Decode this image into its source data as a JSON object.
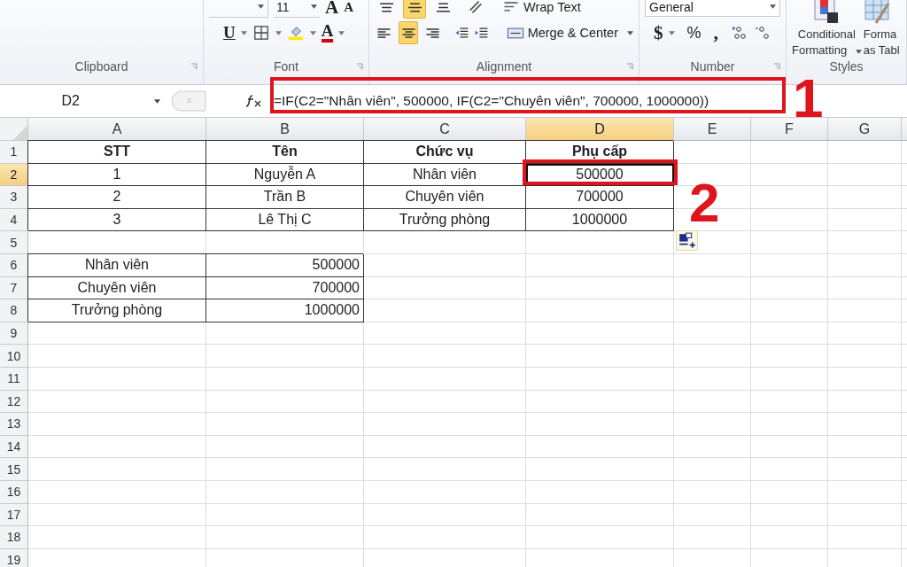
{
  "ribbon": {
    "groups": [
      {
        "kind": "clipboard",
        "label": "Clipboard",
        "launcher": true
      },
      {
        "kind": "font",
        "label": "Font",
        "launcher": true,
        "font_size": "11",
        "grow": "A",
        "shrink": "A",
        "underline": "U",
        "font_color": "A"
      },
      {
        "kind": "alignment",
        "label": "Alignment",
        "launcher": true,
        "vertical_align": [
          {
            "selected": false
          },
          {
            "selected": true
          },
          {
            "selected": false
          }
        ],
        "horizontal_align": [
          {
            "selected": false
          },
          {
            "selected": true
          },
          {
            "selected": false
          }
        ],
        "wrap_text": "Wrap Text",
        "merge": "Merge & Center"
      },
      {
        "kind": "number",
        "label": "Number",
        "launcher": true,
        "format": "General",
        "currency": "$",
        "percent": "%",
        "comma": ","
      },
      {
        "kind": "styles",
        "label": "Styles",
        "launcher": false,
        "conditional": [
          "Conditional",
          "Formatting"
        ],
        "format_table": [
          "Forma",
          "as Tabl"
        ]
      }
    ]
  },
  "formula_bar": {
    "name_box": "D2",
    "formula": "=IF(C2=\"Nhân viên\", 500000, IF(C2=\"Chuyên viên\", 700000, 1000000))"
  },
  "sheet": {
    "columns": [
      {
        "label": "A",
        "selected": false
      },
      {
        "label": "B",
        "selected": false
      },
      {
        "label": "C",
        "selected": false
      },
      {
        "label": "D",
        "selected": true
      },
      {
        "label": "E",
        "selected": false
      },
      {
        "label": "F",
        "selected": false
      },
      {
        "label": "G",
        "selected": false
      }
    ],
    "rows": [
      {
        "label": "1",
        "selected": false,
        "cells": [
          {
            "text": "STT",
            "kind": "centered",
            "bold": true,
            "border": true,
            "selected": false
          },
          {
            "text": "Tên",
            "kind": "centered",
            "bold": true,
            "border": true,
            "selected": false
          },
          {
            "text": "Chức vụ",
            "kind": "centered",
            "bold": true,
            "border": true,
            "selected": false
          },
          {
            "text": "Phụ cấp",
            "kind": "centered",
            "bold": true,
            "border": true,
            "selected": false
          }
        ]
      },
      {
        "label": "2",
        "selected": true,
        "cells": [
          {
            "text": "1",
            "kind": "centered",
            "bold": false,
            "border": true,
            "selected": false
          },
          {
            "text": "Nguyễn A",
            "kind": "centered",
            "bold": false,
            "border": true,
            "selected": false
          },
          {
            "text": "Nhân viên",
            "kind": "centered",
            "bold": false,
            "border": true,
            "selected": false
          },
          {
            "text": "500000",
            "kind": "centered",
            "bold": false,
            "border": true,
            "selected": true
          }
        ]
      },
      {
        "label": "3",
        "selected": false,
        "cells": [
          {
            "text": "2",
            "kind": "centered",
            "bold": false,
            "border": true,
            "selected": false
          },
          {
            "text": "Trần B",
            "kind": "centered",
            "bold": false,
            "border": true,
            "selected": false
          },
          {
            "text": "Chuyên viên",
            "kind": "centered",
            "bold": false,
            "border": true,
            "selected": false
          },
          {
            "text": "700000",
            "kind": "centered",
            "bold": false,
            "border": true,
            "selected": false
          }
        ]
      },
      {
        "label": "4",
        "selected": false,
        "cells": [
          {
            "text": "3",
            "kind": "centered",
            "bold": false,
            "border": true,
            "selected": false
          },
          {
            "text": "Lê Thị C",
            "kind": "centered",
            "bold": false,
            "border": true,
            "selected": false
          },
          {
            "text": "Trưởng phòng",
            "kind": "centered",
            "bold": false,
            "border": true,
            "selected": false
          },
          {
            "text": "1000000",
            "kind": "centered",
            "bold": false,
            "border": true,
            "selected": false
          }
        ]
      },
      {
        "label": "5",
        "selected": false
      },
      {
        "label": "6",
        "selected": false,
        "cells": [
          {
            "text": "Nhân viên",
            "kind": "centered",
            "bold": false,
            "border": true,
            "selected": false
          },
          {
            "text": "500000",
            "kind": "right",
            "bold": false,
            "border": true,
            "selected": false
          }
        ]
      },
      {
        "label": "7",
        "selected": false,
        "cells": [
          {
            "text": "Chuyên viên",
            "kind": "centered",
            "bold": false,
            "border": true,
            "selected": false
          },
          {
            "text": "700000",
            "kind": "right",
            "bold": false,
            "border": true,
            "selected": false
          }
        ]
      },
      {
        "label": "8",
        "selected": false,
        "cells": [
          {
            "text": "Trưởng phòng",
            "kind": "centered",
            "bold": false,
            "border": true,
            "selected": false
          },
          {
            "text": "1000000",
            "kind": "right",
            "bold": false,
            "border": true,
            "selected": false
          }
        ]
      },
      {
        "label": "9",
        "selected": false
      },
      {
        "label": "10",
        "selected": false
      },
      {
        "label": "11",
        "selected": false
      },
      {
        "label": "12",
        "selected": false
      },
      {
        "label": "13",
        "selected": false
      },
      {
        "label": "14",
        "selected": false
      },
      {
        "label": "15",
        "selected": false
      },
      {
        "label": "16",
        "selected": false
      },
      {
        "label": "17",
        "selected": false
      },
      {
        "label": "18",
        "selected": false
      },
      {
        "label": "19",
        "selected": false
      }
    ]
  },
  "annotations": {
    "formula_marker": "1",
    "cell_marker": "2"
  }
}
